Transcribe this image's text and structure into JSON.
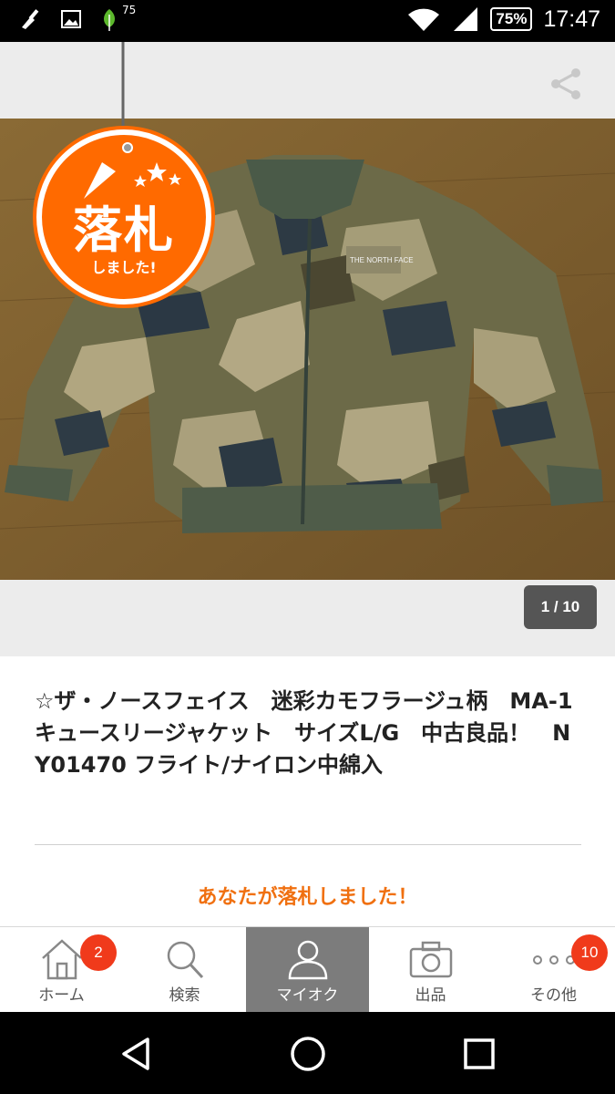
{
  "status_bar": {
    "leaf_count": "75",
    "battery": "75%",
    "time": "17:47"
  },
  "photo": {
    "counter": "1 / 10",
    "brand_print": "THE NORTH FACE"
  },
  "sold_tag": {
    "main": "落札",
    "sub": "しました!"
  },
  "item": {
    "title": "☆ザ・ノースフェイス　迷彩カモフラージュ柄　MA-1　キュースリージャケット　サイズL/G　中古良品！　NY01470 フライト/ナイロン中綿入",
    "won_message": "あなたが落札しました！"
  },
  "tabs": [
    {
      "label": "ホーム",
      "icon": "home-icon",
      "badge": "2"
    },
    {
      "label": "検索",
      "icon": "search-icon",
      "badge": ""
    },
    {
      "label": "マイオク",
      "icon": "user-icon",
      "badge": ""
    },
    {
      "label": "出品",
      "icon": "camera-icon",
      "badge": ""
    },
    {
      "label": "その他",
      "icon": "more-icon",
      "badge": "10"
    }
  ],
  "colors": {
    "accent": "#f07010",
    "tag_orange": "#ff6a00",
    "badge_red": "#f03a1b",
    "active_tab": "#7c7c7c"
  }
}
